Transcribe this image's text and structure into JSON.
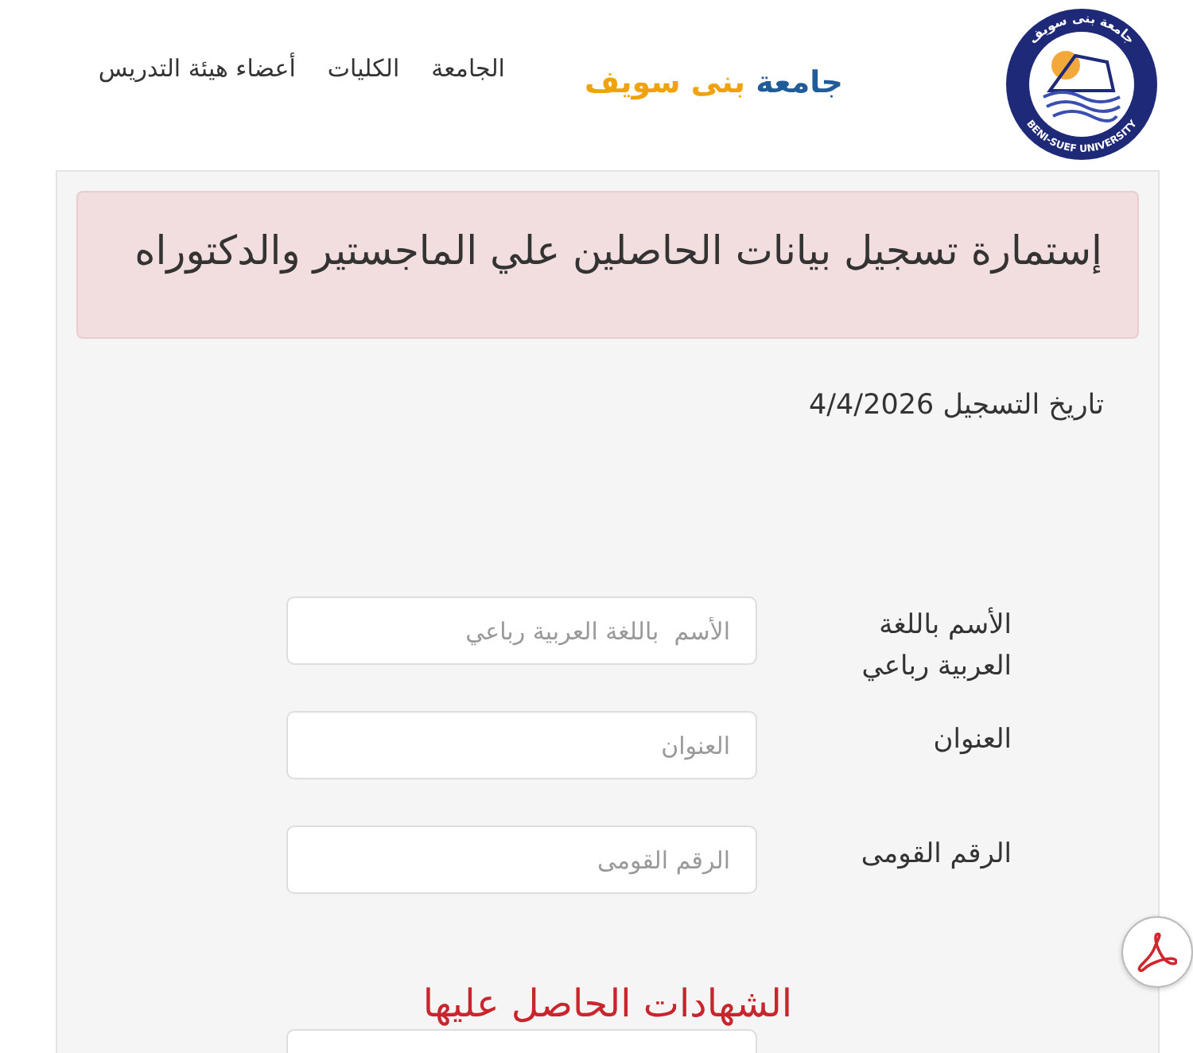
{
  "header": {
    "logo": {
      "ring_text_top": "جامعة بنى سويف",
      "ring_text_bottom": "BENI-SUEF UNIVERSITY"
    },
    "brand": {
      "first_word": "جامعة",
      "rest": "بنى سويف"
    },
    "nav": [
      {
        "label": "الجامعة"
      },
      {
        "label": "الكليات"
      },
      {
        "label": "أعضاء هيئة التدريس"
      }
    ]
  },
  "form": {
    "title": "إستمارة تسجيل بيانات الحاصلين علي الماجستير والدكتوراه",
    "registration_date": "تاريخ التسجيل 4/4/2026",
    "fields": [
      {
        "label": "الأسم باللغة العربية رباعي",
        "placeholder": "الأسم  باللغة العربية رباعي"
      },
      {
        "label": "العنوان",
        "placeholder": "العنوان"
      },
      {
        "label": "الرقم القومى",
        "placeholder": "الرقم القومى"
      }
    ],
    "section_heading": "الشهادات الحاصل عليها",
    "section_fields": [
      {
        "kind": "text_input"
      }
    ]
  },
  "floating_buttons": [
    {
      "kind": "pdf"
    }
  ]
}
